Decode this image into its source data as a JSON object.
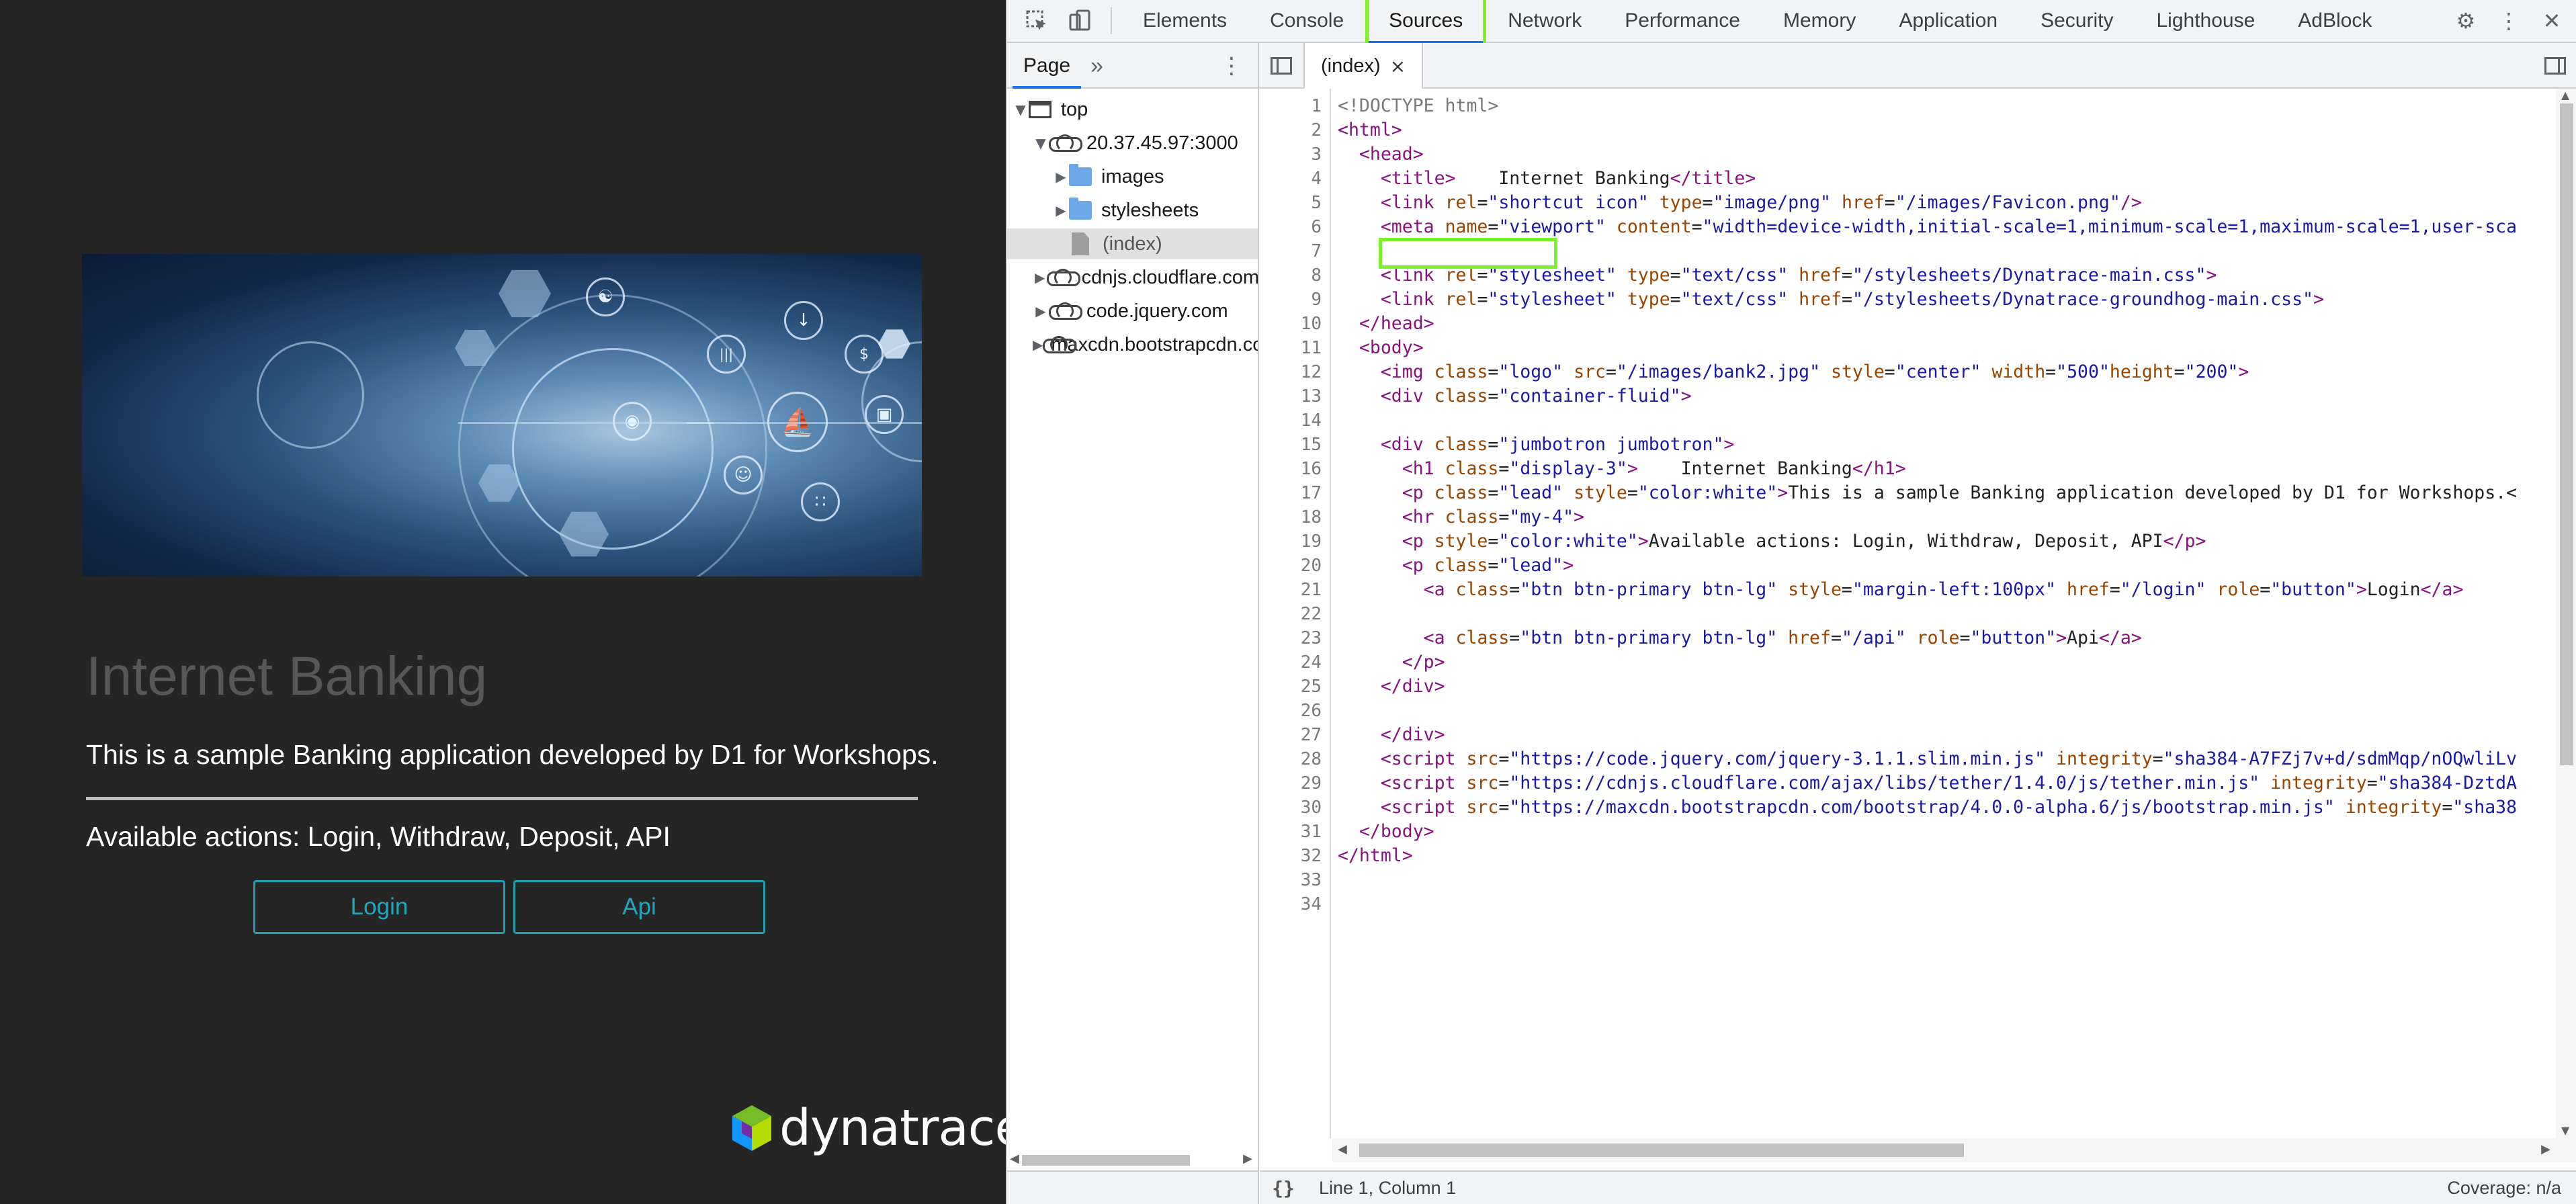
{
  "page": {
    "title": "Internet Banking",
    "lead": "This is a sample Banking application developed by D1 for Workshops.",
    "actions_text": "Available actions: Login, Withdraw, Deposit, API",
    "buttons": {
      "login": "Login",
      "api": "Api"
    },
    "logo_text": "dynatrace",
    "hero_image": "hero-banking-image"
  },
  "devtools": {
    "tabs": [
      "Elements",
      "Console",
      "Sources",
      "Network",
      "Performance",
      "Memory",
      "Application",
      "Security",
      "Lighthouse",
      "AdBlock"
    ],
    "active_tab": "Sources",
    "active_color": "#7cf12b",
    "navigator": {
      "tab": "Page",
      "more": "»",
      "tree": [
        {
          "label": "top",
          "icon": "frame-icon",
          "expanded": true,
          "level": 0
        },
        {
          "label": "20.37.45.97:3000",
          "icon": "cloud-icon",
          "expanded": true,
          "level": 1
        },
        {
          "label": "images",
          "icon": "folder-icon",
          "expanded": false,
          "level": 2
        },
        {
          "label": "stylesheets",
          "icon": "folder-icon",
          "expanded": false,
          "level": 2
        },
        {
          "label": "(index)",
          "icon": "file-icon",
          "selected": true,
          "level": 2
        },
        {
          "label": "cdnjs.cloudflare.com",
          "icon": "cloud-icon",
          "expanded": false,
          "level": 1
        },
        {
          "label": "code.jquery.com",
          "icon": "cloud-icon",
          "expanded": false,
          "level": 1
        },
        {
          "label": "maxcdn.bootstrapcdn.com",
          "icon": "cloud-icon",
          "expanded": false,
          "level": 1
        }
      ]
    },
    "editor": {
      "file_tab": "(index)",
      "close": "×",
      "line_count": 34,
      "lines": [
        [
          [
            "cm",
            "<!DOCTYPE html>"
          ]
        ],
        [
          [
            "tag",
            "<html>"
          ]
        ],
        [
          [
            "t",
            "  "
          ],
          [
            "tag",
            "<head>"
          ]
        ],
        [
          [
            "t",
            "    "
          ],
          [
            "tag",
            "<title>"
          ],
          [
            "t",
            "    Internet Banking"
          ],
          [
            "tag",
            "</title>"
          ]
        ],
        [
          [
            "t",
            "    "
          ],
          [
            "tag",
            "<link "
          ],
          [
            "attr",
            "rel"
          ],
          [
            "t",
            "="
          ],
          [
            "val",
            "\"shortcut icon\""
          ],
          [
            "t",
            " "
          ],
          [
            "attr",
            "type"
          ],
          [
            "t",
            "="
          ],
          [
            "val",
            "\"image/png\""
          ],
          [
            "t",
            " "
          ],
          [
            "attr",
            "href"
          ],
          [
            "t",
            "="
          ],
          [
            "val",
            "\"/images/Favicon.png\""
          ],
          [
            "tag",
            "/>"
          ]
        ],
        [
          [
            "t",
            "    "
          ],
          [
            "tag",
            "<meta "
          ],
          [
            "attr",
            "name"
          ],
          [
            "t",
            "="
          ],
          [
            "val",
            "\"viewport\""
          ],
          [
            "t",
            " "
          ],
          [
            "attr",
            "content"
          ],
          [
            "t",
            "="
          ],
          [
            "val",
            "\"width=device-width,initial-scale=1,minimum-scale=1,maximum-scale=1,user-sca"
          ]
        ],
        [
          [
            "t",
            ""
          ]
        ],
        [
          [
            "t",
            "    "
          ],
          [
            "tag",
            "<link "
          ],
          [
            "attr",
            "rel"
          ],
          [
            "t",
            "="
          ],
          [
            "val",
            "\"stylesheet\""
          ],
          [
            "t",
            " "
          ],
          [
            "attr",
            "type"
          ],
          [
            "t",
            "="
          ],
          [
            "val",
            "\"text/css\""
          ],
          [
            "t",
            " "
          ],
          [
            "attr",
            "href"
          ],
          [
            "t",
            "="
          ],
          [
            "val",
            "\"/stylesheets/Dynatrace-main.css\""
          ],
          [
            "tag",
            ">"
          ]
        ],
        [
          [
            "t",
            "    "
          ],
          [
            "tag",
            "<link "
          ],
          [
            "attr",
            "rel"
          ],
          [
            "t",
            "="
          ],
          [
            "val",
            "\"stylesheet\""
          ],
          [
            "t",
            " "
          ],
          [
            "attr",
            "type"
          ],
          [
            "t",
            "="
          ],
          [
            "val",
            "\"text/css\""
          ],
          [
            "t",
            " "
          ],
          [
            "attr",
            "href"
          ],
          [
            "t",
            "="
          ],
          [
            "val",
            "\"/stylesheets/Dynatrace-groundhog-main.css\""
          ],
          [
            "tag",
            ">"
          ]
        ],
        [
          [
            "t",
            "  "
          ],
          [
            "tag",
            "</head>"
          ]
        ],
        [
          [
            "t",
            "  "
          ],
          [
            "tag",
            "<body>"
          ]
        ],
        [
          [
            "t",
            "    "
          ],
          [
            "tag",
            "<img "
          ],
          [
            "attr",
            "class"
          ],
          [
            "t",
            "="
          ],
          [
            "val",
            "\"logo\""
          ],
          [
            "t",
            " "
          ],
          [
            "attr",
            "src"
          ],
          [
            "t",
            "="
          ],
          [
            "val",
            "\"/images/bank2.jpg\""
          ],
          [
            "t",
            " "
          ],
          [
            "attr",
            "style"
          ],
          [
            "t",
            "="
          ],
          [
            "val",
            "\"center\""
          ],
          [
            "t",
            " "
          ],
          [
            "attr",
            "width"
          ],
          [
            "t",
            "="
          ],
          [
            "val",
            "\"500\""
          ],
          [
            "attr",
            "height"
          ],
          [
            "t",
            "="
          ],
          [
            "val",
            "\"200\""
          ],
          [
            "tag",
            ">"
          ]
        ],
        [
          [
            "t",
            "    "
          ],
          [
            "tag",
            "<div "
          ],
          [
            "attr",
            "class"
          ],
          [
            "t",
            "="
          ],
          [
            "val",
            "\"container-fluid\""
          ],
          [
            "tag",
            ">"
          ]
        ],
        [
          [
            "t",
            ""
          ]
        ],
        [
          [
            "t",
            "    "
          ],
          [
            "tag",
            "<div "
          ],
          [
            "attr",
            "class"
          ],
          [
            "t",
            "="
          ],
          [
            "val",
            "\"jumbotron jumbotron\""
          ],
          [
            "tag",
            ">"
          ]
        ],
        [
          [
            "t",
            "      "
          ],
          [
            "tag",
            "<h1 "
          ],
          [
            "attr",
            "class"
          ],
          [
            "t",
            "="
          ],
          [
            "val",
            "\"display-3\""
          ],
          [
            "tag",
            ">"
          ],
          [
            "t",
            "    Internet Banking"
          ],
          [
            "tag",
            "</h1>"
          ]
        ],
        [
          [
            "t",
            "      "
          ],
          [
            "tag",
            "<p "
          ],
          [
            "attr",
            "class"
          ],
          [
            "t",
            "="
          ],
          [
            "val",
            "\"lead\""
          ],
          [
            "t",
            " "
          ],
          [
            "attr",
            "style"
          ],
          [
            "t",
            "="
          ],
          [
            "val",
            "\"color:white\""
          ],
          [
            "tag",
            ">"
          ],
          [
            "t",
            "This is a sample Banking application developed by D1 for Workshops.<"
          ]
        ],
        [
          [
            "t",
            "      "
          ],
          [
            "tag",
            "<hr "
          ],
          [
            "attr",
            "class"
          ],
          [
            "t",
            "="
          ],
          [
            "val",
            "\"my-4\""
          ],
          [
            "tag",
            ">"
          ]
        ],
        [
          [
            "t",
            "      "
          ],
          [
            "tag",
            "<p "
          ],
          [
            "attr",
            "style"
          ],
          [
            "t",
            "="
          ],
          [
            "val",
            "\"color:white\""
          ],
          [
            "tag",
            ">"
          ],
          [
            "t",
            "Available actions: Login, Withdraw, Deposit, API"
          ],
          [
            "tag",
            "</p>"
          ]
        ],
        [
          [
            "t",
            "      "
          ],
          [
            "tag",
            "<p "
          ],
          [
            "attr",
            "class"
          ],
          [
            "t",
            "="
          ],
          [
            "val",
            "\"lead\""
          ],
          [
            "tag",
            ">"
          ]
        ],
        [
          [
            "t",
            "        "
          ],
          [
            "tag",
            "<a "
          ],
          [
            "attr",
            "class"
          ],
          [
            "t",
            "="
          ],
          [
            "val",
            "\"btn btn-primary btn-lg\""
          ],
          [
            "t",
            " "
          ],
          [
            "attr",
            "style"
          ],
          [
            "t",
            "="
          ],
          [
            "val",
            "\"margin-left:100px\""
          ],
          [
            "t",
            " "
          ],
          [
            "attr",
            "href"
          ],
          [
            "t",
            "="
          ],
          [
            "val",
            "\"/login\""
          ],
          [
            "t",
            " "
          ],
          [
            "attr",
            "role"
          ],
          [
            "t",
            "="
          ],
          [
            "val",
            "\"button\""
          ],
          [
            "tag",
            ">"
          ],
          [
            "t",
            "Login"
          ],
          [
            "tag",
            "</a>"
          ]
        ],
        [
          [
            "t",
            ""
          ]
        ],
        [
          [
            "t",
            "        "
          ],
          [
            "tag",
            "<a "
          ],
          [
            "attr",
            "class"
          ],
          [
            "t",
            "="
          ],
          [
            "val",
            "\"btn btn-primary btn-lg\""
          ],
          [
            "t",
            " "
          ],
          [
            "attr",
            "href"
          ],
          [
            "t",
            "="
          ],
          [
            "val",
            "\"/api\""
          ],
          [
            "t",
            " "
          ],
          [
            "attr",
            "role"
          ],
          [
            "t",
            "="
          ],
          [
            "val",
            "\"button\""
          ],
          [
            "tag",
            ">"
          ],
          [
            "t",
            "Api"
          ],
          [
            "tag",
            "</a>"
          ]
        ],
        [
          [
            "t",
            "      "
          ],
          [
            "tag",
            "</p>"
          ]
        ],
        [
          [
            "t",
            "    "
          ],
          [
            "tag",
            "</div>"
          ]
        ],
        [
          [
            "t",
            ""
          ]
        ],
        [
          [
            "t",
            "    "
          ],
          [
            "tag",
            "</div>"
          ]
        ],
        [
          [
            "t",
            "    "
          ],
          [
            "tag",
            "<script "
          ],
          [
            "attr",
            "src"
          ],
          [
            "t",
            "="
          ],
          [
            "val",
            "\"https://code.jquery.com/jquery-3.1.1.slim.min.js\""
          ],
          [
            "t",
            " "
          ],
          [
            "attr",
            "integrity"
          ],
          [
            "t",
            "="
          ],
          [
            "val",
            "\"sha384-A7FZj7v+d/sdmMqp/nOQwliLv"
          ]
        ],
        [
          [
            "t",
            "    "
          ],
          [
            "tag",
            "<script "
          ],
          [
            "attr",
            "src"
          ],
          [
            "t",
            "="
          ],
          [
            "val",
            "\"https://cdnjs.cloudflare.com/ajax/libs/tether/1.4.0/js/tether.min.js\""
          ],
          [
            "t",
            " "
          ],
          [
            "attr",
            "integrity"
          ],
          [
            "t",
            "="
          ],
          [
            "val",
            "\"sha384-DztdA"
          ]
        ],
        [
          [
            "t",
            "    "
          ],
          [
            "tag",
            "<script "
          ],
          [
            "attr",
            "src"
          ],
          [
            "t",
            "="
          ],
          [
            "val",
            "\"https://maxcdn.bootstrapcdn.com/bootstrap/4.0.0-alpha.6/js/bootstrap.min.js\""
          ],
          [
            "t",
            " "
          ],
          [
            "attr",
            "integrity"
          ],
          [
            "t",
            "="
          ],
          [
            "val",
            "\"sha38"
          ]
        ],
        [
          [
            "t",
            "  "
          ],
          [
            "tag",
            "</body>"
          ]
        ],
        [
          [
            "tag",
            "</html>"
          ]
        ],
        [
          [
            "t",
            ""
          ]
        ],
        [
          [
            "t",
            ""
          ]
        ]
      ]
    },
    "status": {
      "pretty_print": "{}",
      "cursor": "Line 1, Column 1",
      "coverage": "Coverage: n/a"
    }
  }
}
